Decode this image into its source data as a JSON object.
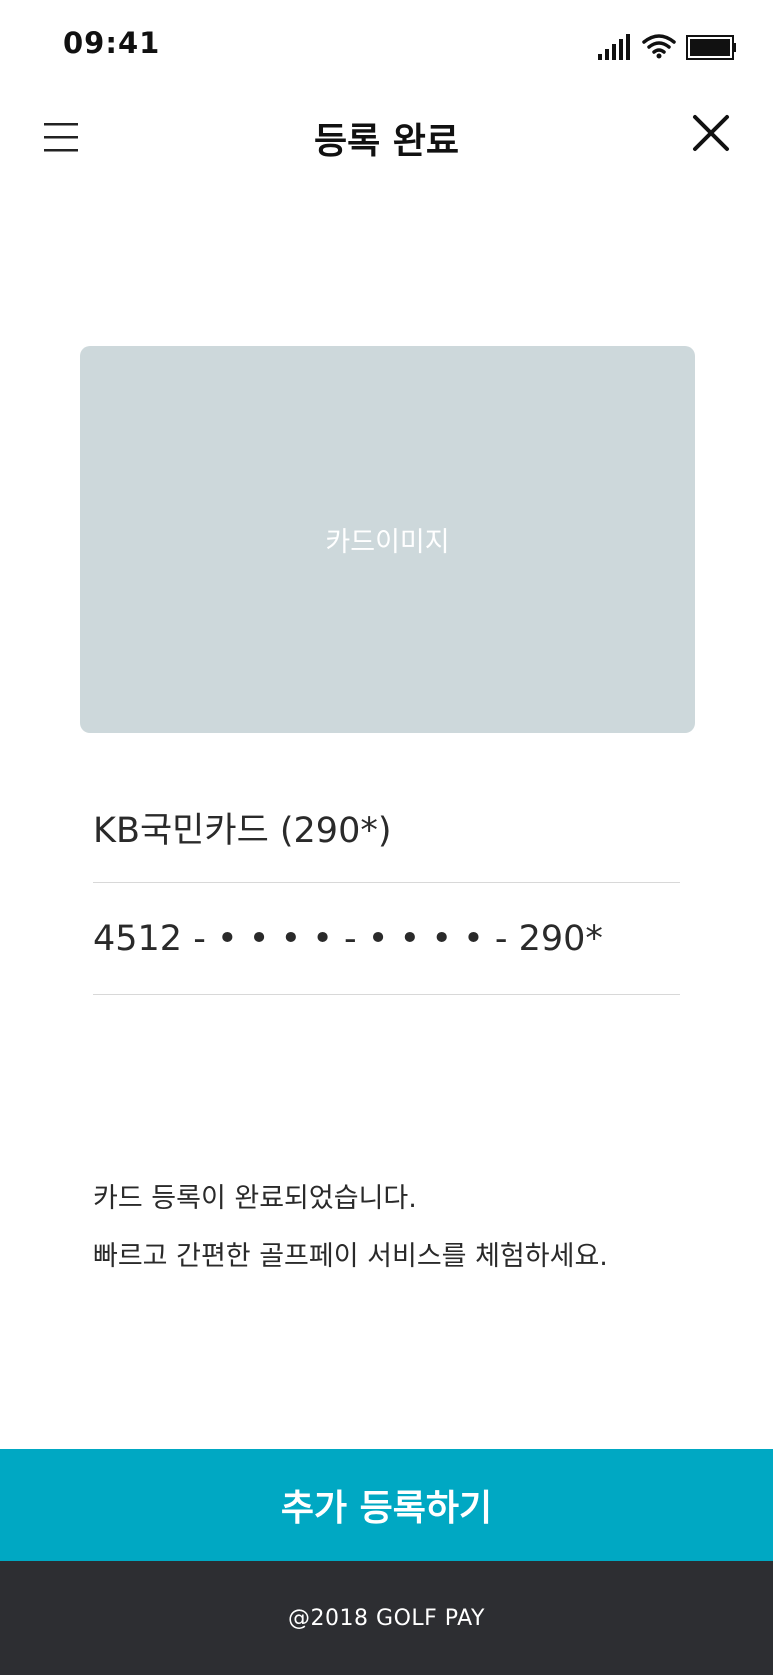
{
  "status_bar": {
    "time": "09:41",
    "icons": [
      "signal-icon",
      "wifi-icon",
      "battery-icon"
    ]
  },
  "header": {
    "title": "등록 완료",
    "left_icon": "menu-icon",
    "right_icon": "close-icon"
  },
  "card": {
    "image_placeholder": "카드이미지",
    "name": "KB국민카드 (290*)",
    "number": "4512 - • • • • - • • • • - 290*"
  },
  "message": {
    "line1": "카드 등록이 완료되었습니다.",
    "line2": "빠르고 간편한 골프페이 서비스를 체험하세요."
  },
  "actions": {
    "add_label": "추가 등록하기"
  },
  "footer": {
    "copyright": "@2018  GOLF PAY"
  },
  "colors": {
    "accent": "#00a8c3",
    "card_placeholder": "#cdd8db",
    "footer_bg": "#2d2e32"
  }
}
